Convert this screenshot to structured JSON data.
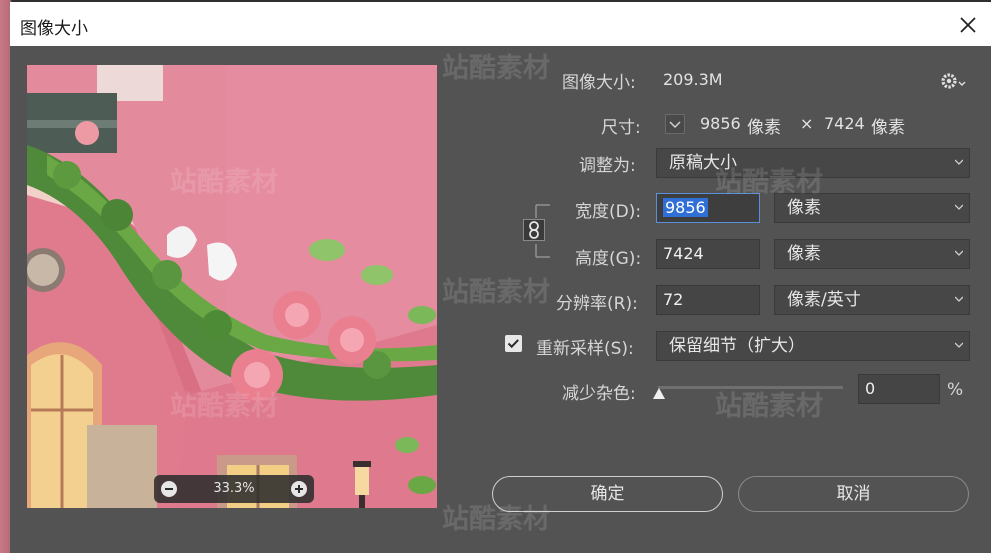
{
  "window": {
    "title": "图像大小"
  },
  "preview": {
    "zoom": "33.3%"
  },
  "image_size": {
    "label": "图像大小:",
    "value": "209.3M"
  },
  "dimensions": {
    "label": "尺寸:",
    "width": "9856",
    "width_unit": "像素",
    "separator": "×",
    "height": "7424",
    "height_unit": "像素"
  },
  "fit_to": {
    "label": "调整为:",
    "value": "原稿大小"
  },
  "width_row": {
    "label": "宽度(D):",
    "value": "9856",
    "unit": "像素"
  },
  "height_row": {
    "label": "高度(G):",
    "value": "7424",
    "unit": "像素"
  },
  "resolution_row": {
    "label": "分辨率(R):",
    "value": "72",
    "unit": "像素/英寸"
  },
  "resample": {
    "label": "重新采样(S):",
    "checked": true,
    "method": "保留细节（扩大）"
  },
  "noise": {
    "label": "减少杂色:",
    "value": "0",
    "unit": "%",
    "level": 0
  },
  "buttons": {
    "ok": "确定",
    "cancel": "取消"
  },
  "watermark": {
    "text": "站酷素材"
  },
  "colors": {
    "dialog_bg": "#535353",
    "field_bg": "#454545",
    "selection": "#2f6fd6",
    "preview_pink": "#e48a9d"
  }
}
